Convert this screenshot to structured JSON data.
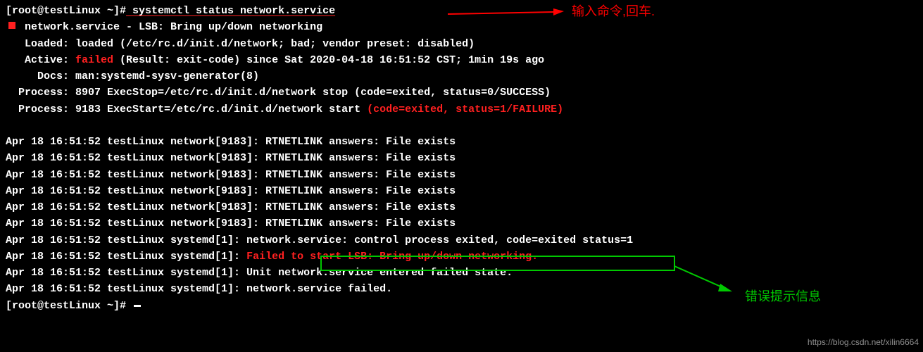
{
  "prompt1": "[root@testLinux ~]#",
  "command": " systemctl status network.service",
  "service_line_a": " network.service - LSB: Bring up/down networking",
  "loaded_line": "   Loaded: loaded (/etc/rc.d/init.d/network; bad; vendor preset: disabled)",
  "active_label": "   Active: ",
  "active_failed": "failed",
  "active_rest": " (Result: exit-code) since Sat 2020-04-18 16:51:52 CST; 1min 19s ago",
  "docs_line": "     Docs: man:systemd-sysv-generator(8)",
  "process1": "  Process: 8907 ExecStop=/etc/rc.d/init.d/network stop (code=exited, status=0/SUCCESS)",
  "process2_a": "  Process: 9183 ExecStart=/etc/rc.d/init.d/network start ",
  "process2_b": "(code=exited, status=1/FAILURE)",
  "log1": "Apr 18 16:51:52 testLinux network[9183]: RTNETLINK answers: File exists",
  "log2": "Apr 18 16:51:52 testLinux network[9183]: RTNETLINK answers: File exists",
  "log3": "Apr 18 16:51:52 testLinux network[9183]: RTNETLINK answers: File exists",
  "log4": "Apr 18 16:51:52 testLinux network[9183]: RTNETLINK answers: File exists",
  "log5": "Apr 18 16:51:52 testLinux network[9183]: RTNETLINK answers: File exists",
  "log6": "Apr 18 16:51:52 testLinux network[9183]: RTNETLINK answers: File exists",
  "log7": "Apr 18 16:51:52 testLinux systemd[1]: network.service: control process exited, code=exited status=1",
  "log8_a": "Apr 18 16:51:52 testLinux systemd[1]: ",
  "log8_b": "Failed to start LSB: Bring up/down networking.",
  "log9": "Apr 18 16:51:52 testLinux systemd[1]: Unit network.service entered failed state.",
  "log10": "Apr 18 16:51:52 testLinux systemd[1]: network.service failed.",
  "prompt2": "[root@testLinux ~]# ",
  "annotation_input": "输入命令,回车.",
  "annotation_error": "错误提示信息",
  "watermark": "https://blog.csdn.net/xilin6664"
}
